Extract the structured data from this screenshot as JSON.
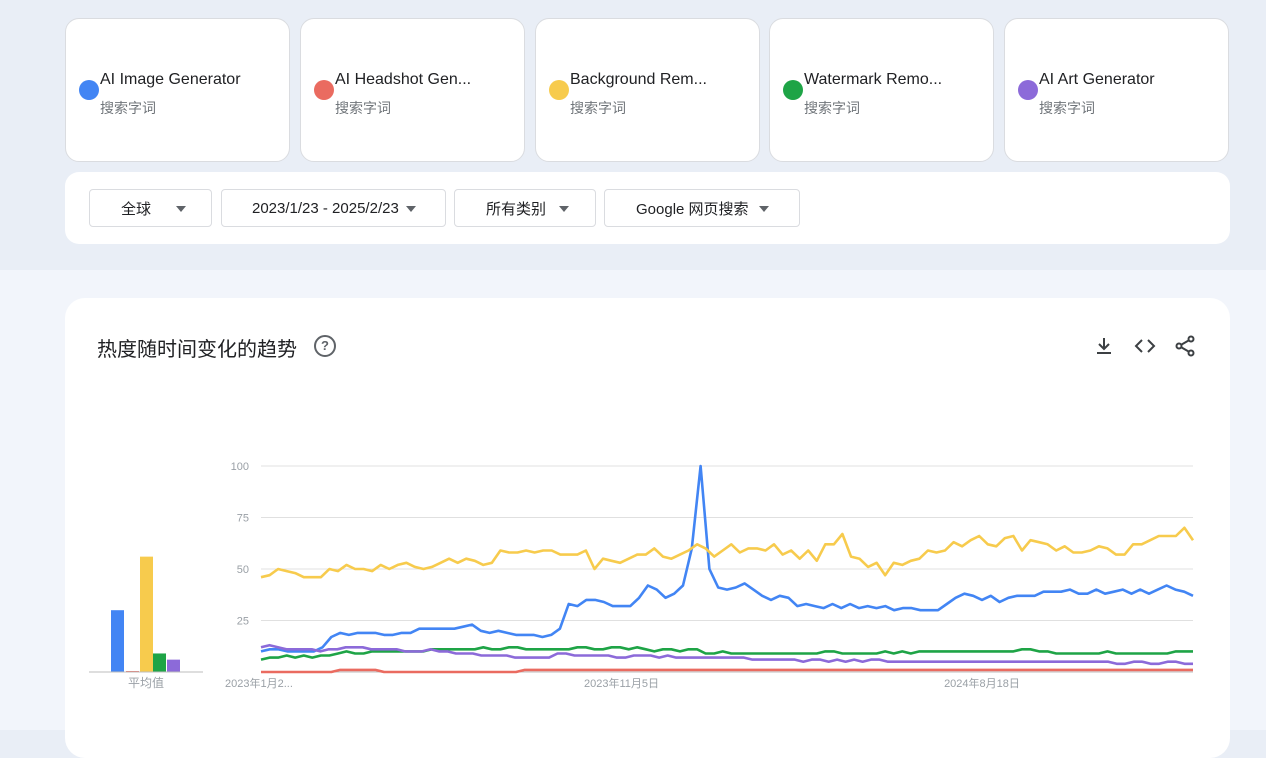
{
  "terms": [
    {
      "name": "AI Image Generator",
      "type": "搜索字词",
      "color": "#4285f4"
    },
    {
      "name": "AI Headshot Gen...",
      "type": "搜索字词",
      "color": "#ea6b60"
    },
    {
      "name": "Background Rem...",
      "type": "搜索字词",
      "color": "#f7cb4d"
    },
    {
      "name": "Watermark Remo...",
      "type": "搜索字词",
      "color": "#1ea446"
    },
    {
      "name": "AI Art Generator",
      "type": "搜索字词",
      "color": "#8c6ad9"
    }
  ],
  "filters": {
    "region": "全球",
    "date_range": "2023/1/23 - 2025/2/23",
    "category": "所有类别",
    "search_type": "Google 网页搜索"
  },
  "panel": {
    "title": "热度随时间变化的趋势",
    "help_icon": "help-circle-icon",
    "actions": [
      "download-icon",
      "embed-code-icon",
      "share-icon"
    ]
  },
  "chart_data": {
    "type": "line",
    "ylim": [
      0,
      100
    ],
    "yticks": [
      100,
      75,
      50,
      25
    ],
    "x_tick_labels": [
      "2023年1月2...",
      "2023年11月5日",
      "2024年8月18日"
    ],
    "x_tick_indices": [
      0,
      41,
      82
    ],
    "average_label": "平均值",
    "averages": [
      30,
      0,
      56,
      9,
      6
    ],
    "series": [
      {
        "name": "AI Image Generator",
        "color": "#4285f4",
        "values": [
          10,
          11,
          11,
          10,
          10,
          10,
          10,
          12,
          17,
          19,
          18,
          19,
          19,
          19,
          18,
          18,
          19,
          19,
          21,
          21,
          21,
          21,
          21,
          22,
          23,
          20,
          19,
          20,
          19,
          18,
          18,
          18,
          17,
          18,
          21,
          33,
          32,
          35,
          35,
          34,
          32,
          32,
          32,
          36,
          42,
          40,
          36,
          38,
          42,
          60,
          100,
          50,
          41,
          40,
          41,
          43,
          40,
          37,
          35,
          37,
          36,
          32,
          33,
          32,
          31,
          33,
          31,
          33,
          31,
          32,
          31,
          32,
          30,
          31,
          31,
          30,
          30,
          30,
          33,
          36,
          38,
          37,
          35,
          37,
          34,
          36,
          37,
          37,
          37,
          39,
          39,
          39,
          40,
          38,
          38,
          40,
          38,
          39,
          40,
          38,
          40,
          38,
          40,
          42,
          40,
          39,
          37
        ]
      },
      {
        "name": "AI Headshot Gen...",
        "color": "#ea6b60",
        "values": [
          0,
          0,
          0,
          0,
          0,
          0,
          0,
          0,
          0,
          1,
          1,
          1,
          1,
          1,
          0,
          0,
          0,
          0,
          0,
          0,
          0,
          0,
          0,
          0,
          0,
          0,
          0,
          0,
          0,
          0,
          1,
          1,
          1,
          1,
          1,
          1,
          1,
          1,
          1,
          1,
          1,
          1,
          1,
          1,
          1,
          1,
          1,
          1,
          1,
          1,
          1,
          1,
          1,
          1,
          1,
          1,
          1,
          1,
          1,
          1,
          1,
          1,
          1,
          1,
          1,
          1,
          1,
          1,
          1,
          1,
          1,
          1,
          1,
          1,
          1,
          1,
          1,
          1,
          1,
          1,
          1,
          1,
          1,
          1,
          1,
          1,
          1,
          1,
          1,
          1,
          1,
          1,
          1,
          1,
          1,
          1,
          1,
          1,
          1,
          1,
          1,
          1,
          1,
          1,
          1,
          1,
          1
        ]
      },
      {
        "name": "Background Rem...",
        "color": "#f7cb4d",
        "values": [
          46,
          47,
          50,
          49,
          48,
          46,
          46,
          46,
          50,
          49,
          52,
          50,
          50,
          49,
          52,
          50,
          52,
          53,
          51,
          50,
          51,
          53,
          55,
          53,
          55,
          54,
          52,
          53,
          59,
          58,
          58,
          59,
          58,
          59,
          59,
          57,
          57,
          57,
          59,
          50,
          55,
          54,
          53,
          55,
          57,
          57,
          60,
          56,
          55,
          57,
          59,
          62,
          60,
          56,
          59,
          62,
          58,
          60,
          60,
          59,
          62,
          57,
          59,
          55,
          59,
          54,
          62,
          62,
          67,
          56,
          55,
          51,
          53,
          47,
          53,
          52,
          54,
          55,
          59,
          58,
          59,
          63,
          61,
          64,
          66,
          62,
          61,
          65,
          66,
          59,
          64,
          63,
          62,
          59,
          61,
          58,
          58,
          59,
          61,
          60,
          57,
          57,
          62,
          62,
          64,
          66,
          66,
          66,
          70,
          64
        ]
      },
      {
        "name": "Watermark Remo...",
        "color": "#1ea446",
        "values": [
          6,
          7,
          7,
          8,
          7,
          8,
          7,
          8,
          8,
          9,
          10,
          9,
          9,
          10,
          10,
          10,
          10,
          10,
          10,
          10,
          11,
          11,
          11,
          11,
          11,
          11,
          12,
          11,
          11,
          12,
          12,
          11,
          11,
          11,
          11,
          11,
          11,
          12,
          12,
          11,
          11,
          12,
          12,
          11,
          12,
          11,
          10,
          11,
          11,
          10,
          11,
          11,
          9,
          9,
          10,
          9,
          9,
          9,
          9,
          9,
          9,
          9,
          9,
          9,
          9,
          9,
          10,
          10,
          9,
          9,
          9,
          9,
          9,
          10,
          9,
          10,
          9,
          10,
          10,
          10,
          10,
          10,
          10,
          10,
          10,
          10,
          10,
          10,
          10,
          11,
          11,
          10,
          10,
          9,
          9,
          9,
          9,
          9,
          9,
          10,
          9,
          9,
          9,
          9,
          9,
          9,
          9,
          10,
          10,
          10
        ]
      },
      {
        "name": "AI Art Generator",
        "color": "#8c6ad9",
        "values": [
          12,
          13,
          12,
          11,
          11,
          11,
          11,
          10,
          11,
          11,
          12,
          12,
          12,
          11,
          11,
          11,
          11,
          10,
          10,
          10,
          11,
          10,
          10,
          9,
          9,
          9,
          8,
          8,
          8,
          8,
          7,
          7,
          7,
          7,
          7,
          9,
          9,
          8,
          8,
          8,
          8,
          8,
          7,
          7,
          8,
          8,
          8,
          7,
          8,
          7,
          7,
          7,
          7,
          7,
          7,
          7,
          7,
          7,
          6,
          6,
          6,
          6,
          6,
          6,
          5,
          6,
          6,
          5,
          6,
          5,
          6,
          5,
          6,
          6,
          5,
          5,
          5,
          5,
          5,
          5,
          5,
          5,
          5,
          5,
          5,
          5,
          5,
          5,
          5,
          5,
          5,
          5,
          5,
          5,
          5,
          5,
          5,
          5,
          5,
          5,
          5,
          4,
          4,
          5,
          5,
          4,
          4,
          5,
          5,
          4,
          4
        ]
      }
    ]
  }
}
